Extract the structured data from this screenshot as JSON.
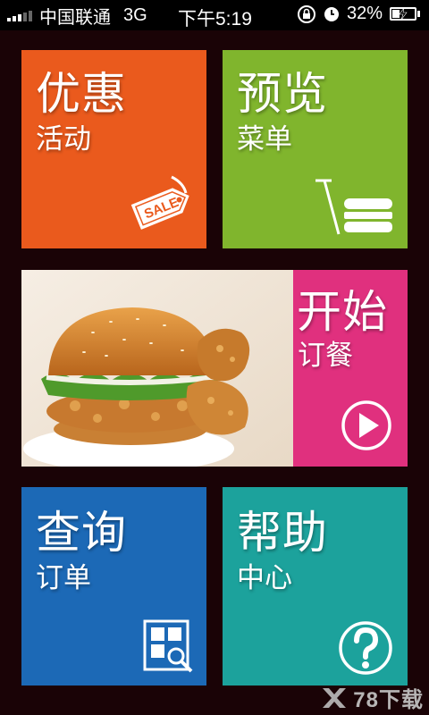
{
  "status_bar": {
    "carrier": "中国联通",
    "network": "3G",
    "time": "下午5:19",
    "battery_percent": "32%",
    "battery_level": 0.32
  },
  "tiles": {
    "promo": {
      "title": "优惠",
      "subtitle": "活动",
      "color": "#ea5a1d",
      "icon": "sale-tag-icon",
      "icon_text": "SALE"
    },
    "menu": {
      "title": "预览",
      "subtitle": "菜单",
      "color": "#80b52d",
      "icon": "cart-burger-icon"
    },
    "order": {
      "title": "开始",
      "subtitle": "订餐",
      "color": "#e0307e",
      "icon": "play-icon",
      "image": "burger-and-fried-chicken-photo"
    },
    "query": {
      "title": "查询",
      "subtitle": "订单",
      "color": "#1c69b6",
      "icon": "search-order-icon"
    },
    "help": {
      "title": "帮助",
      "subtitle": "中心",
      "color": "#1ca29c",
      "icon": "question-icon"
    }
  },
  "watermark": {
    "text": "78下载"
  }
}
